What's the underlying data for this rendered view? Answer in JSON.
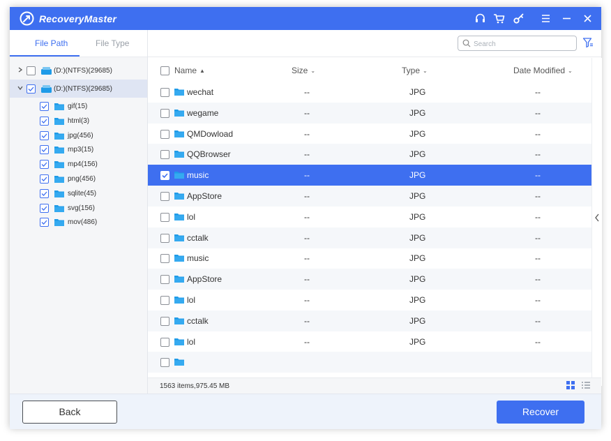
{
  "app": {
    "title": "RecoveryMaster"
  },
  "titlebar": {
    "icons": [
      "headset-icon",
      "cart-icon",
      "key-icon",
      "menu-icon",
      "minimize-icon",
      "close-icon"
    ]
  },
  "sidebar": {
    "tabs": [
      {
        "label": "File Path",
        "active": true
      },
      {
        "label": "File Type",
        "active": false
      }
    ],
    "drives": [
      {
        "label": "(D:)(NTFS)(29685)",
        "expanded": false,
        "checked": false
      },
      {
        "label": "(D:)(NTFS)(29685)",
        "expanded": true,
        "checked": true,
        "selected": true
      }
    ],
    "folders": [
      {
        "label": "gif(15)",
        "checked": true
      },
      {
        "label": "html(3)",
        "checked": true
      },
      {
        "label": "jpg(456)",
        "checked": true
      },
      {
        "label": "mp3(15)",
        "checked": true
      },
      {
        "label": "mp4(156)",
        "checked": true
      },
      {
        "label": "png(456)",
        "checked": true
      },
      {
        "label": "sqlite(45)",
        "checked": true
      },
      {
        "label": "svg(156)",
        "checked": true
      },
      {
        "label": "mov(486)",
        "checked": true
      }
    ]
  },
  "toolbar": {
    "search_placeholder": "Search",
    "filter_icon": "filter-icon"
  },
  "table": {
    "columns": {
      "name": "Name",
      "size": "Size",
      "type": "Type",
      "date": "Date Modified"
    },
    "rows": [
      {
        "name": "wechat",
        "size": "--",
        "type": "JPG",
        "date": "--",
        "checked": false
      },
      {
        "name": "wegame",
        "size": "--",
        "type": "JPG",
        "date": "--",
        "checked": false
      },
      {
        "name": "QMDowload",
        "size": "--",
        "type": "JPG",
        "date": "--",
        "checked": false
      },
      {
        "name": "QQBrowser",
        "size": "--",
        "type": "JPG",
        "date": "--",
        "checked": false
      },
      {
        "name": "music",
        "size": "--",
        "type": "JPG",
        "date": "--",
        "checked": true,
        "selected": true
      },
      {
        "name": "AppStore",
        "size": "--",
        "type": "JPG",
        "date": "--",
        "checked": false
      },
      {
        "name": "lol",
        "size": "--",
        "type": "JPG",
        "date": "--",
        "checked": false
      },
      {
        "name": "cctalk",
        "size": "--",
        "type": "JPG",
        "date": "--",
        "checked": false
      },
      {
        "name": "music",
        "size": "--",
        "type": "JPG",
        "date": "--",
        "checked": false
      },
      {
        "name": "AppStore",
        "size": "--",
        "type": "JPG",
        "date": "--",
        "checked": false
      },
      {
        "name": "lol",
        "size": "--",
        "type": "JPG",
        "date": "--",
        "checked": false
      },
      {
        "name": "cctalk",
        "size": "--",
        "type": "JPG",
        "date": "--",
        "checked": false
      },
      {
        "name": "lol",
        "size": "--",
        "type": "JPG",
        "date": "--",
        "checked": false
      },
      {
        "name": "",
        "size": "",
        "type": "",
        "date": "",
        "checked": false
      }
    ]
  },
  "status": {
    "summary": "1563 items,975.45 MB"
  },
  "footer": {
    "back_label": "Back",
    "recover_label": "Recover"
  },
  "colors": {
    "accent": "#3e6ff0",
    "folder": "#1e9be8"
  }
}
